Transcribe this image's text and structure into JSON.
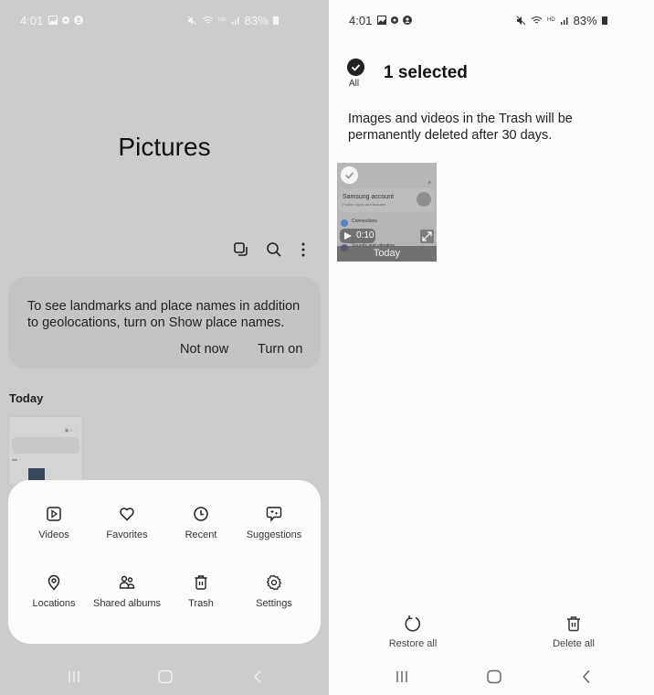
{
  "left_screen": {
    "status_bar": {
      "time": "4:01",
      "left_icons": [
        "gallery-icon",
        "gear-icon",
        "account-icon"
      ],
      "right_icons": [
        "mute-vibrate-icon",
        "wifi-icon",
        "hd-voice-icon",
        "signal-icon"
      ],
      "hd_label": "HD",
      "battery": "83%"
    },
    "title": "Pictures",
    "toolbar": [
      "select-multiple-icon",
      "search-icon",
      "more-options-icon"
    ],
    "banner": {
      "message": "To see landmarks and place names in addition to geolocations, turn on Show place names.",
      "not_now": "Not now",
      "turn_on": "Turn on"
    },
    "section_label": "Today",
    "menu_sheet": {
      "items": [
        {
          "label": "Videos",
          "icon": "video-icon"
        },
        {
          "label": "Favorites",
          "icon": "heart-icon"
        },
        {
          "label": "Recent",
          "icon": "clock-icon"
        },
        {
          "label": "Suggestions",
          "icon": "suggestions-icon"
        },
        {
          "label": "Locations",
          "icon": "location-pin-icon"
        },
        {
          "label": "Shared albums",
          "icon": "people-icon"
        },
        {
          "label": "Trash",
          "icon": "trash-icon"
        },
        {
          "label": "Settings",
          "icon": "gear-icon"
        }
      ]
    }
  },
  "right_screen": {
    "status_bar": {
      "time": "4:01",
      "hd_label": "HD",
      "battery": "83%"
    },
    "select_all_label": "All",
    "selection_title": "1 selected",
    "info": "Images and videos in the Trash will be permanently deleted after 30 days.",
    "thumbnail": {
      "inner_title": "Samsung account",
      "inner_subtitle": "Profile • Apps and features",
      "inner_row1": "Connections",
      "inner_row2": "Sounds and vibration",
      "duration": "0:10",
      "date_label": "Today",
      "selected": true
    },
    "actions": {
      "restore": "Restore all",
      "delete": "Delete all"
    }
  },
  "nav": [
    "recent-apps-icon",
    "home-icon",
    "back-icon"
  ]
}
